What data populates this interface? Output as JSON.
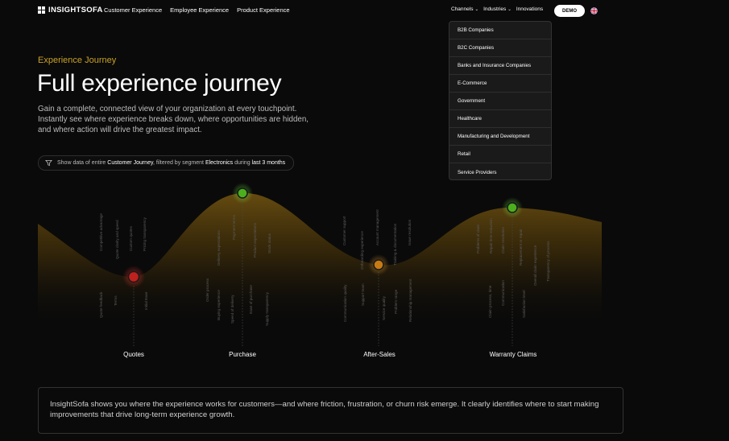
{
  "nav": {
    "brand": "INSIGHTSOFA",
    "links": [
      "Customer Experience",
      "Employee Experience",
      "Product Experience"
    ],
    "channels": "Channels",
    "industries": "Industries",
    "innovations": "Innovations",
    "demo": "DEMO"
  },
  "dropdown": {
    "items": [
      "B2B Companies",
      "B2C Companies",
      "Banks and Insurance Companies",
      "E-Commerce",
      "Government",
      "Healthcare",
      "Manufacturing and Development",
      "Retail",
      "Service Providers"
    ]
  },
  "hero": {
    "eyebrow": "Experience Journey",
    "title": "Full experience journey",
    "description": "Gain a complete, connected view of your organization at every touchpoint. Instantly see where experience breaks down, where opportunities are hidden, and where action will drive the greatest impact."
  },
  "filter": {
    "prefix": "Show data of entire",
    "journey": "Customer Journey",
    "middle": ", filtered by segment",
    "segment": "Electronics",
    "during": "during",
    "period": "last 3 months"
  },
  "stages": [
    {
      "name": "Quotes",
      "status": "negative",
      "color": "#c0211e"
    },
    {
      "name": "Purchase",
      "status": "positive",
      "color": "#4caf1e"
    },
    {
      "name": "After-Sales",
      "status": "neutral",
      "color": "#c97a12"
    },
    {
      "name": "Warranty Claims",
      "status": "positive",
      "color": "#4caf1e"
    }
  ],
  "info": {
    "text": "InsightSofa shows you where the experience works for customers—and where friction, frustration, or churn risk emerge. It clearly identifies where to start making improvements that drive long-term experience growth."
  }
}
